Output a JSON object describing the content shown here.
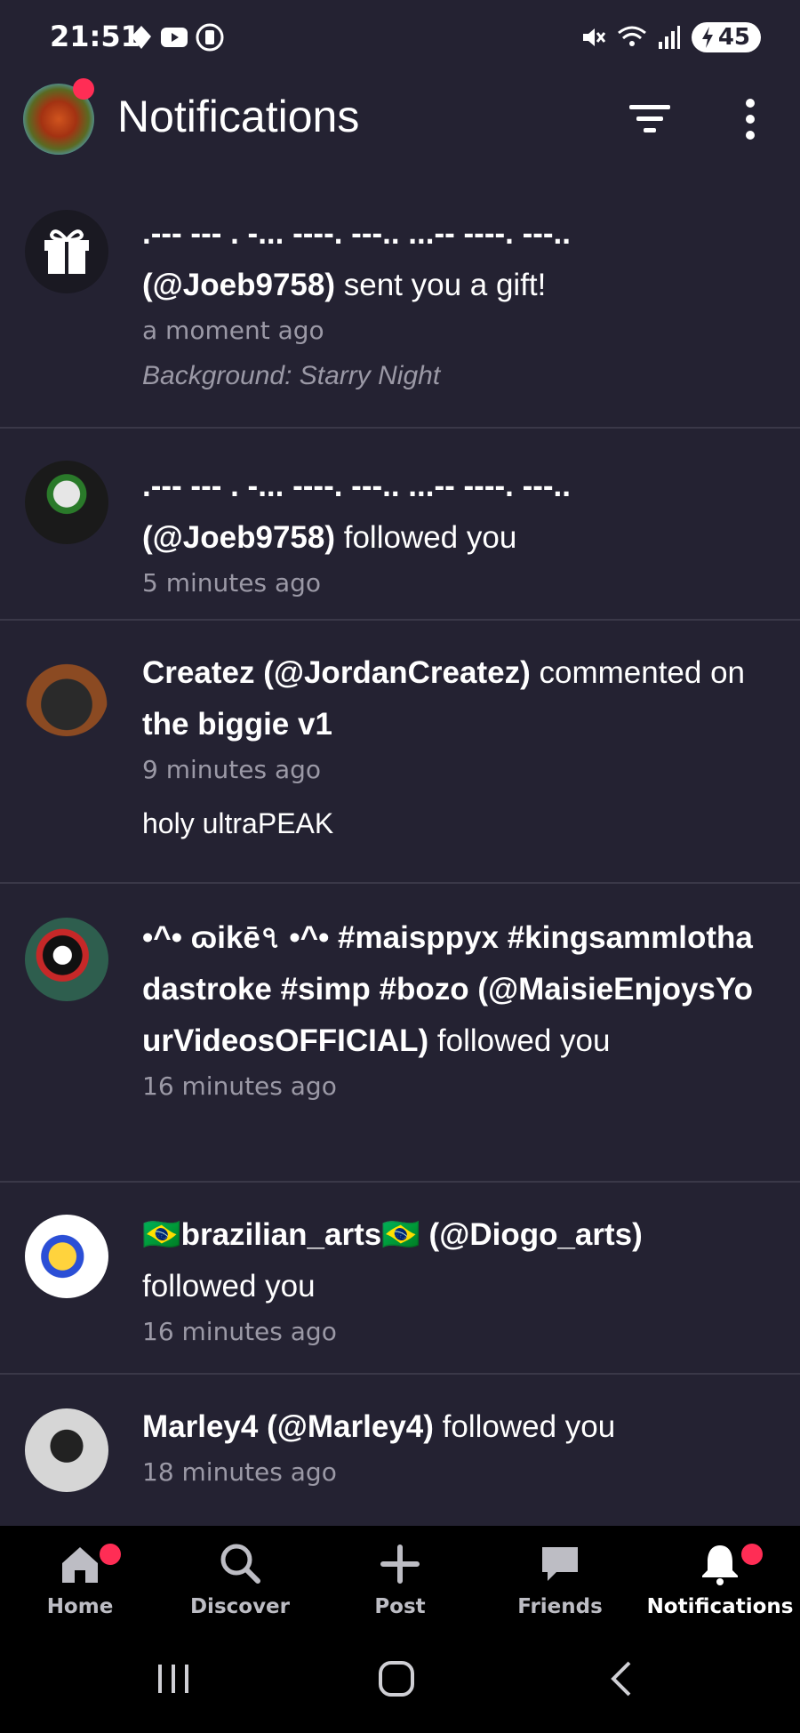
{
  "status_bar": {
    "time": "21:51",
    "battery": "45",
    "icons_left": [
      "location-icon",
      "youtube-icon",
      "app-icon"
    ],
    "icons_right": [
      "mute-icon",
      "wifi-icon",
      "signal-icon",
      "battery-icon"
    ]
  },
  "header": {
    "title": "Notifications",
    "avatar_badge": true
  },
  "notifications": [
    {
      "name": ".--- --- . -... ----. ---.. ...-- ----. ---..",
      "handle": "(@Joeb9758)",
      "action": "sent you a gift!",
      "time": "a moment ago",
      "detail": "Background: Starry Night",
      "avatar": "gift-icon"
    },
    {
      "name": ".--- --- . -... ----. ---.. ...-- ----. ---..",
      "handle": "(@Joeb9758)",
      "action": "followed you",
      "time": "5 minutes ago"
    },
    {
      "name": "Createz",
      "handle": "(@JordanCreatez)",
      "action": "commented on",
      "target": "the biggie v1",
      "time": "9 minutes ago",
      "comment": "holy ultraPEAK"
    },
    {
      "name": "•^• ɷikē৭ •^• #maisppyx #kingsammlothadastroke #simp #bozo",
      "handle": "(@MaisieEnjoysYourVideosOFFICIAL)",
      "action": "followed you",
      "time": "16 minutes ago"
    },
    {
      "name": "🇧🇷brazilian_arts🇧🇷",
      "handle": "(@Diogo_arts)",
      "action": "followed you",
      "time": "16 minutes ago"
    },
    {
      "name": "Marley4",
      "handle": "(@Marley4)",
      "action": "followed you",
      "time": "18 minutes ago"
    }
  ],
  "bottom_nav": [
    {
      "label": "Home",
      "icon": "home-icon",
      "badge": true
    },
    {
      "label": "Discover",
      "icon": "search-icon",
      "badge": false
    },
    {
      "label": "Post",
      "icon": "plus-icon",
      "badge": false
    },
    {
      "label": "Friends",
      "icon": "chat-icon",
      "badge": false
    },
    {
      "label": "Notifications",
      "icon": "bell-icon",
      "badge": true,
      "active": true
    }
  ],
  "system_nav": [
    "recents-button",
    "home-button",
    "back-button"
  ],
  "colors": {
    "background": "#242232",
    "badge": "#ff2d55",
    "muted_text": "#9b99a6",
    "nav_background": "#000000"
  }
}
